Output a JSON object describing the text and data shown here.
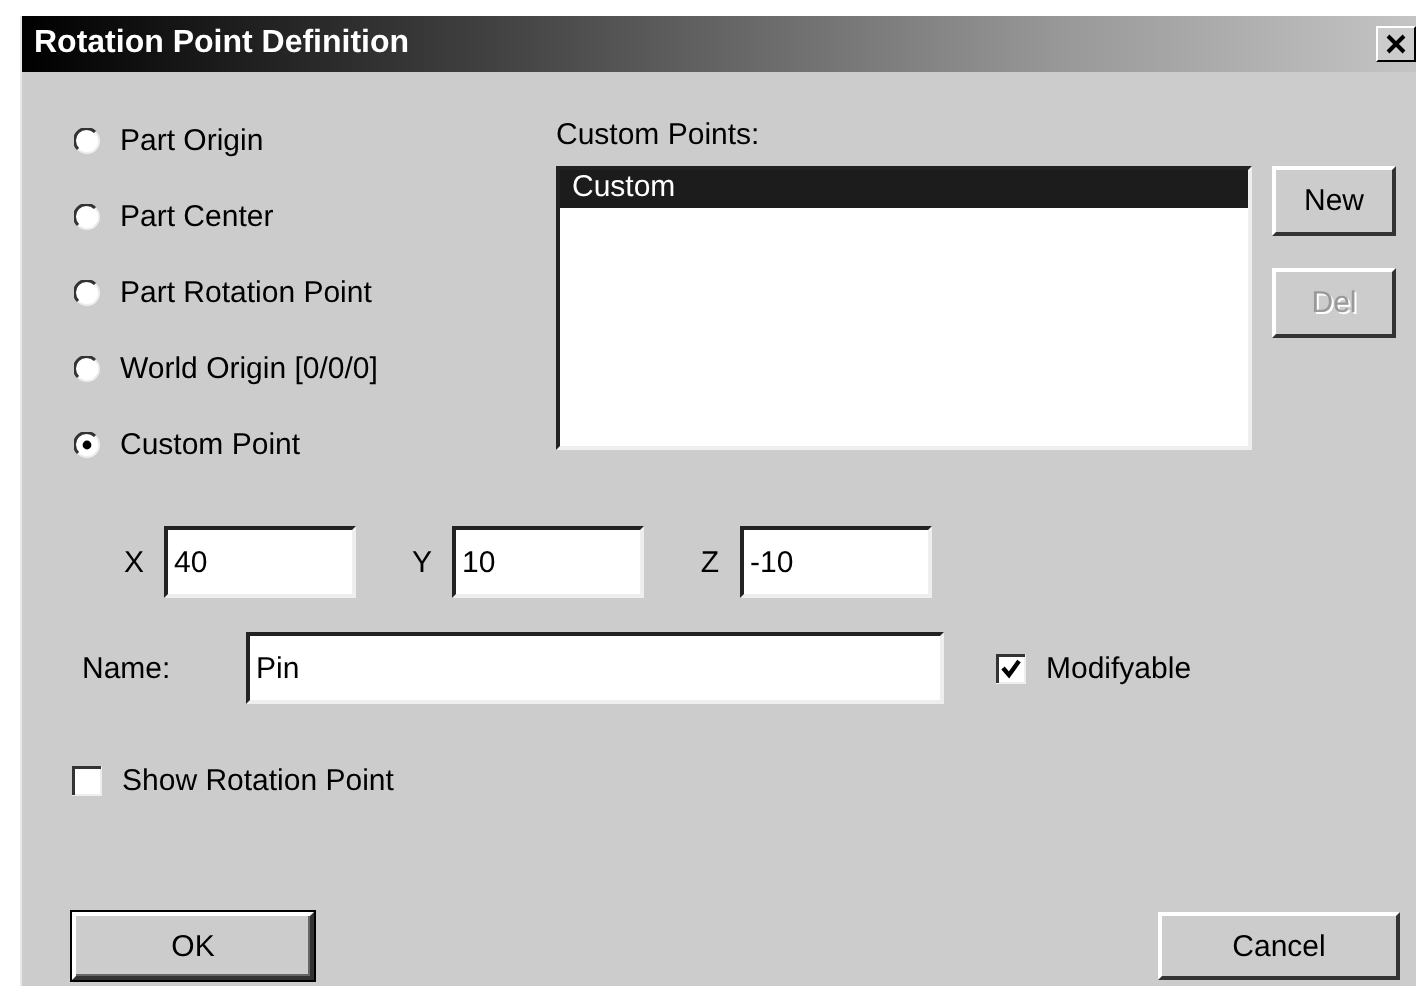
{
  "window": {
    "title": "Rotation Point Definition"
  },
  "origin_options": [
    {
      "label": "Part Origin",
      "selected": false
    },
    {
      "label": "Part Center",
      "selected": false
    },
    {
      "label": "Part Rotation Point",
      "selected": false
    },
    {
      "label": "World Origin [0/0/0]",
      "selected": false
    },
    {
      "label": "Custom Point",
      "selected": true
    }
  ],
  "custom_points": {
    "label": "Custom Points:",
    "items": [
      {
        "label": "Custom",
        "selected": true
      }
    ]
  },
  "list_buttons": [
    {
      "label": "New",
      "disabled": false
    },
    {
      "label": "Del",
      "disabled": true
    }
  ],
  "coordinates": [
    {
      "label": "X",
      "value": "40"
    },
    {
      "label": "Y",
      "value": "10"
    },
    {
      "label": "Z",
      "value": "-10"
    }
  ],
  "name": {
    "label": "Name:",
    "value": "Pin"
  },
  "modifyable": {
    "label": "Modifyable",
    "checked": true
  },
  "show_rotation_point": {
    "label": "Show Rotation Point",
    "checked": false
  },
  "footer_buttons": [
    {
      "label": "OK",
      "default": true
    },
    {
      "label": "Cancel",
      "default": false
    }
  ]
}
